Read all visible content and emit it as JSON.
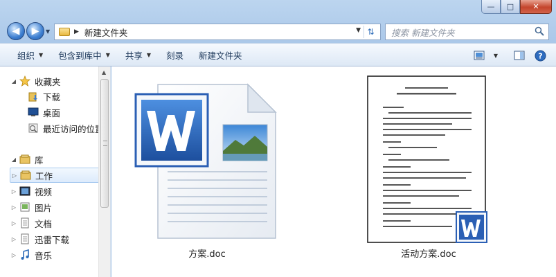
{
  "window": {
    "minimize_glyph": "—",
    "maximize_glyph": "□",
    "close_glyph": "✕"
  },
  "address_bar": {
    "path": "新建文件夹",
    "search_placeholder": "搜索 新建文件夹"
  },
  "toolbar": {
    "organize": "组织",
    "include_in_library": "包含到库中",
    "share": "共享",
    "burn": "刻录",
    "new_folder": "新建文件夹"
  },
  "sidebar": {
    "favorites": {
      "label": "收藏夹",
      "items": [
        "下载",
        "桌面",
        "最近访问的位置"
      ]
    },
    "libraries": {
      "label": "库",
      "items": [
        "工作",
        "视频",
        "图片",
        "文档",
        "迅雷下载",
        "音乐"
      ]
    }
  },
  "files": [
    {
      "name": "方案.doc"
    },
    {
      "name": "活动方案.doc"
    }
  ],
  "colors": {
    "frame": "#bcd5ef",
    "word_blue": "#2b5fb4",
    "selection": "#dcebfc"
  }
}
